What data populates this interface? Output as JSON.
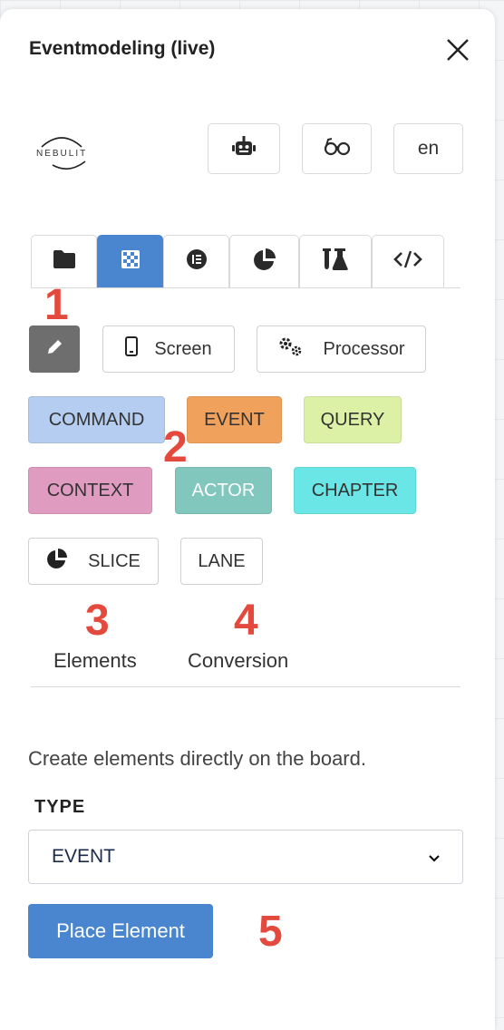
{
  "header": {
    "title": "Eventmodeling (live)"
  },
  "logo": {
    "text": "NEBULIT"
  },
  "toolbar": {
    "lang_label": "en"
  },
  "annotations": [
    "1",
    "2",
    "3",
    "4",
    "5"
  ],
  "elements": {
    "screen_label": "Screen",
    "processor_label": "Processor",
    "chips": [
      {
        "label": "COMMAND",
        "color": "#b4cdf0"
      },
      {
        "label": "EVENT",
        "color": "#f0a25d"
      },
      {
        "label": "QUERY",
        "color": "#dcf0a6"
      },
      {
        "label": "CONTEXT",
        "color": "#e09bc0"
      },
      {
        "label": "ACTOR",
        "color": "#82c7be"
      },
      {
        "label": "CHAPTER",
        "color": "#6ae6e6"
      }
    ],
    "slice_label": "SLICE",
    "lane_label": "LANE"
  },
  "subtabs": {
    "elements": "Elements",
    "conversion": "Conversion"
  },
  "form": {
    "description": "Create elements directly on the board.",
    "type_label": "TYPE",
    "type_value": "EVENT",
    "place_button": "Place Element"
  },
  "colors": {
    "accent": "#4a86d0",
    "annotation": "#e34a3d",
    "edit_bg": "#6e6e6e"
  }
}
